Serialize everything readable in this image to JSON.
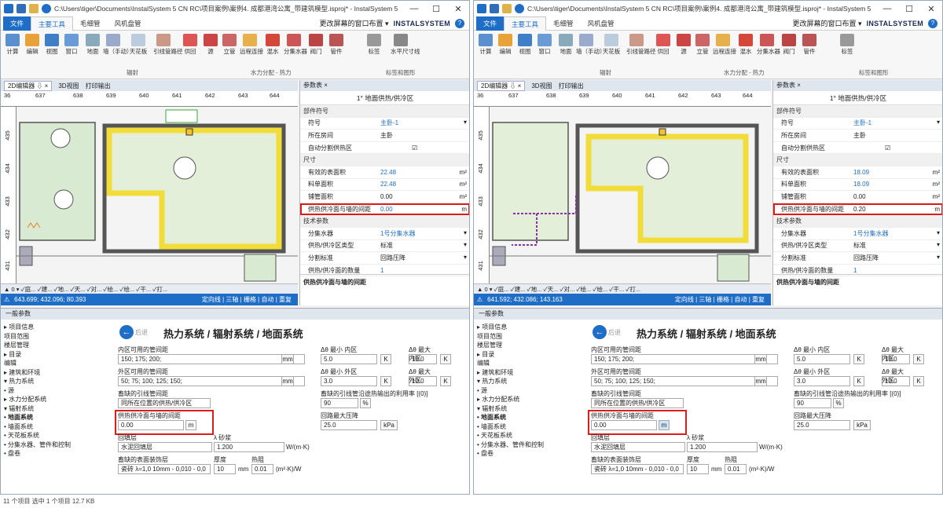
{
  "app_title_left": "C:\\Users\\tiger\\Documents\\InstalSystem 5 CN RC\\项目案例\\案例4. 成都港湾公寓_带建筑模型.isproj* - InstalSystem 5 Editor...",
  "app_title_right": "C:\\Users\\tiger\\Documents\\InstalSystem 5 CN RC\\项目案例\\案例4. 成都港湾公寓_带建筑模型.isproj* - InstalSystem 5 Edit...",
  "menu": {
    "file": "文件",
    "tabs": [
      "主要工具",
      "毛细管",
      "风机盘管"
    ],
    "layout": "更改屏幕的窗口布置 ▾",
    "brand": "INSTALSYSTEM"
  },
  "ribbon": {
    "buttons": [
      "计算",
      "编辑",
      "视图",
      "窗口",
      "地面",
      "墙（手动）",
      "天花板",
      "引线管路径",
      "供回",
      "源",
      "立管",
      "远程连接",
      "混水",
      "分集水器",
      "阀门",
      "管件",
      "标签",
      "水平尺寸线"
    ],
    "groups": {
      "rad": "辐射",
      "water": "水力分配 - 热力",
      "labels": "标签和图形"
    }
  },
  "panel_tabs": {
    "editor": "2D编辑器 ⇩ ×",
    "view3d": "3D视图",
    "print": "打印输出"
  },
  "ruler_h": [
    "36",
    "637",
    "638",
    "639",
    "640",
    "641",
    "642",
    "643",
    "644"
  ],
  "ruler_v": [
    "435",
    "434",
    "433",
    "432",
    "431"
  ],
  "bottombar": "▲ 0 ▾ ✓庭... ✓建... ✓地... ✓天... ✓对... ✓绘... ✓绘... ✓干... ✓打...",
  "left": {
    "status_coords": "643.699; 432.096; 80.393",
    "status_right": "定向线 | 三轴 | 栅格 | 自动 | 重复",
    "props_tab": "参数表 ×",
    "props_title": "1° 地面供热/供冷区",
    "rows": [
      {
        "t": "sec",
        "l": "部件符号",
        "v": ""
      },
      {
        "t": "row",
        "l": "符号",
        "v": "主卧-1",
        "u": "▾"
      },
      {
        "t": "row",
        "l": "所在房间",
        "v": "主卧",
        "u": ""
      },
      {
        "t": "row",
        "l": "自动分割供热区",
        "v": "☑",
        "u": ""
      },
      {
        "t": "sec",
        "l": "尺寸",
        "v": ""
      },
      {
        "t": "row",
        "l": "有效的表面积",
        "v": "22.48",
        "u": "m²"
      },
      {
        "t": "row",
        "l": "料单面积",
        "v": "22.48",
        "u": "m²"
      },
      {
        "t": "row",
        "l": "铺管面积",
        "v": "0.00",
        "u": "m²"
      },
      {
        "t": "hl",
        "l": "供热供冷面与墙的间距",
        "v": "0.00",
        "u": "m"
      },
      {
        "t": "sec",
        "l": "技术参数",
        "v": ""
      },
      {
        "t": "row",
        "l": "分集水器",
        "v": "1号分集水器",
        "u": "▾"
      },
      {
        "t": "row",
        "l": "供热/供冷区类型",
        "v": "标准",
        "u": "▾"
      },
      {
        "t": "row",
        "l": "分割标准",
        "v": "回路压降",
        "u": "▾"
      },
      {
        "t": "row",
        "l": "供热/供冷面的数量",
        "v": "1",
        "u": ""
      }
    ],
    "desc": "供热供冷面与墙的间距",
    "gap_value": "0.00"
  },
  "right": {
    "status_coords": "641.592; 432.086; 143.163",
    "status_right": "定向线 | 三轴 | 栅格 | 自动 | 重复",
    "props_tab": "参数表 ×",
    "props_title": "1° 地面供热/供冷区",
    "rows": [
      {
        "t": "sec",
        "l": "部件符号",
        "v": ""
      },
      {
        "t": "row",
        "l": "符号",
        "v": "主卧-1",
        "u": "▾"
      },
      {
        "t": "row",
        "l": "所在房间",
        "v": "主卧",
        "u": ""
      },
      {
        "t": "row",
        "l": "自动分割供热区",
        "v": "☑",
        "u": ""
      },
      {
        "t": "sec",
        "l": "尺寸",
        "v": ""
      },
      {
        "t": "row",
        "l": "有效的表面积",
        "v": "18.09",
        "u": "m²"
      },
      {
        "t": "row",
        "l": "料单面积",
        "v": "18.09",
        "u": "m²"
      },
      {
        "t": "row",
        "l": "铺管面积",
        "v": "0.00",
        "u": "m²"
      },
      {
        "t": "hl",
        "l": "供热供冷面与墙的间距",
        "v": "0.20",
        "u": "m"
      },
      {
        "t": "sec",
        "l": "技术参数",
        "v": ""
      },
      {
        "t": "row",
        "l": "分集水器",
        "v": "1号分集水器",
        "u": "▾"
      },
      {
        "t": "row",
        "l": "供热/供冷区类型",
        "v": "标准",
        "u": "▾"
      },
      {
        "t": "row",
        "l": "分割标准",
        "v": "回路压降",
        "u": "▾"
      },
      {
        "t": "row",
        "l": "供热/供冷面的数量",
        "v": "1",
        "u": ""
      }
    ],
    "desc": "供热供冷面与墙的间距",
    "gap_value": "0.00"
  },
  "general": {
    "tab": "一般参数",
    "tree": [
      "▸ 项目信息",
      "  项目范围",
      "  楼层管理",
      "▸ 目录",
      "  编辑",
      "▸ 建筑和环境",
      "▾ 热力系统",
      "    • 源",
      "  ▸ 水力分配系统",
      "  ▾ 辐射系统",
      "      • 地面系统",
      "      • 墙面系统",
      "      • 天花板系统",
      "      • 分集水器、管件和控制",
      "      • 盘卷"
    ],
    "back": "后退",
    "title": "热力系统 / 辐射系统 / 地面系统",
    "inner_lbl": "内区可用的管间距",
    "inner_val": "150; 175; 200;",
    "outer_lbl": "外区可用的管间距",
    "outer_val": "50; 75; 100; 125; 150;",
    "lead_lbl": "畜缺的引线管间距",
    "lead_val": "同所在位置的供热/供冷区",
    "gap_lbl": "供热供冷面与墙的间距",
    "fill_lbl": "回填层",
    "fill_val": "水泥回填层",
    "lambda_lbl": "λ 砂浆",
    "lambda_val": "1.200",
    "lambda_unit": "W/(m·K)",
    "cover_lbl": "畜缺的表面装饰层",
    "cover_val": "瓷砖 λ=1,0 10mm - 0,010 - 0,0",
    "thick_lbl": "厚度",
    "thick_val": "10",
    "res_lbl": "热阻",
    "res_val": "0.01",
    "res_unit": "(m²·K)/W",
    "dmin_in_lbl": "Δθ 最小 内区",
    "dmin_in": "5.0",
    "dmax_in_lbl": "Δθ 最大 内区",
    "dmax_in": "15.0",
    "dmin_out_lbl": "Δθ 最小 外区",
    "dmin_out": "3.0",
    "dmax_out_lbl": "Δθ 最大 外区",
    "dmax_out": "10.0",
    "util_lbl": "畜缺的引线管沿途热输出的利用率 [(0)]",
    "util_val": "90",
    "press_lbl": "回路最大压降",
    "press_val": "25.0",
    "unit_K": "K",
    "unit_pct": "%",
    "unit_kpa": "kPa",
    "unit_mm": "mm",
    "unit_m": "m"
  },
  "explorer_status": "11 个项目   选中 1 个项目  12.7 KB"
}
